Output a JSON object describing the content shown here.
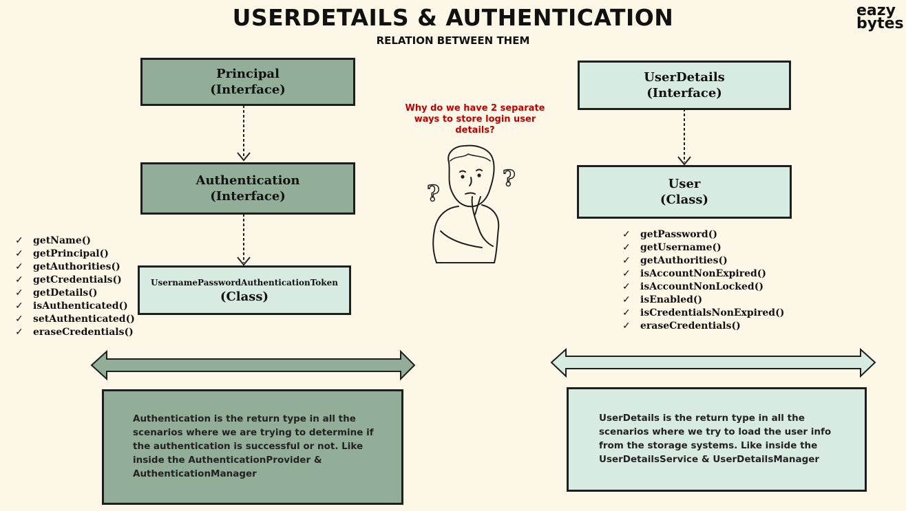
{
  "header": {
    "title": "USERDETAILS & AUTHENTICATION",
    "subtitle": "RELATION BETWEEN THEM",
    "logo_line1": "eazy",
    "logo_line2": "bytes"
  },
  "left": {
    "principal": {
      "name": "Principal",
      "kind": "(Interface)"
    },
    "authentication": {
      "name": "Authentication",
      "kind": "(Interface)"
    },
    "token": {
      "name": "UsernamePasswordAuthenticationToken",
      "kind": "(Class)"
    },
    "methods": [
      "getName()",
      "getPrincipal()",
      "getAuthorities()",
      "getCredentials()",
      "getDetails()",
      "isAuthenticated()",
      "setAuthenticated()",
      "eraseCredentials()"
    ],
    "description": "Authentication is the return type in all the scenarios where we are trying to determine if the authentication is successful or not. Like inside the AuthenticationProvider & AuthenticationManager"
  },
  "right": {
    "userdetails": {
      "name": "UserDetails",
      "kind": "(Interface)"
    },
    "user": {
      "name": "User",
      "kind": "(Class)"
    },
    "methods": [
      "getPassword()",
      "getUsername()",
      "getAuthorities()",
      "isAccountNonExpired()",
      "isAccountNonLocked()",
      "isEnabled()",
      "isCredentialsNonExpired()",
      "eraseCredentials()"
    ],
    "description": "UserDetails is the return type in all the scenarios where we try to load the user info from the storage systems. Like inside the UserDetailsService & UserDetailsManager"
  },
  "center": {
    "question": "Why do we have 2 separate ways to store login user details?",
    "question_marks": [
      "?",
      "?"
    ]
  },
  "tick_symbol": "✓",
  "colors": {
    "background": "#fdf7e7",
    "dark_box": "#92ad98",
    "light_box": "#d8ebe0",
    "question": "#c00000"
  }
}
